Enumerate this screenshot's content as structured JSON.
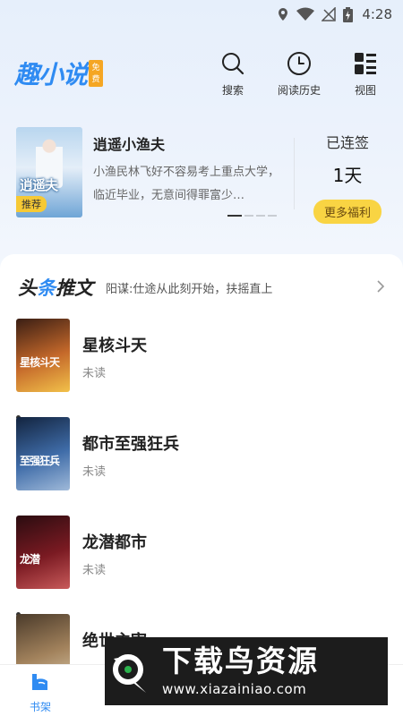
{
  "status_bar": {
    "time": "4:28"
  },
  "header": {
    "logo_text": "趣小说",
    "logo_badge": "免费",
    "actions": [
      {
        "label": "搜索",
        "icon": "search-icon"
      },
      {
        "label": "阅读历史",
        "icon": "clock-icon"
      },
      {
        "label": "视图",
        "icon": "grid-view-icon"
      }
    ]
  },
  "featured": {
    "cover_title": "逍遥夫",
    "tag": "推荐",
    "title": "逍遥小渔夫",
    "description": "小渔民林飞好不容易考上重点大学，临近毕业，无意间得罪富少…",
    "signin_label": "已连签",
    "signin_days": "1天",
    "welfare_button": "更多福利"
  },
  "headline": {
    "title_a": "头",
    "title_b": "条",
    "title_c": "推文",
    "text": "阳谋:仕途从此刻开始，扶摇直上"
  },
  "books": [
    {
      "title": "星核斗天",
      "status": "未读",
      "cover_text": "星核斗天",
      "colors": [
        "#3a1e14",
        "#c4682a",
        "#f2c14a"
      ]
    },
    {
      "title": "都市至强狂兵",
      "status": "未读",
      "cover_text": "至强狂兵",
      "colors": [
        "#12233e",
        "#3f6ca8",
        "#9fb9d9"
      ]
    },
    {
      "title": "龙潜都市",
      "status": "未读",
      "cover_text": "龙潜",
      "colors": [
        "#2a0c10",
        "#7a1a22",
        "#c85a5a"
      ]
    },
    {
      "title": "绝世主宰",
      "status": "",
      "cover_text": "",
      "colors": [
        "#4a3a2a",
        "#a2825c",
        "#d8c7a8"
      ]
    }
  ],
  "tabbar": {
    "shelf_label": "书架"
  },
  "watermark": {
    "main": "下载鸟资源",
    "sub": "www.xiazainiao.com"
  },
  "colors": {
    "accent": "#2f8bf2",
    "yellow": "#f9d443"
  }
}
